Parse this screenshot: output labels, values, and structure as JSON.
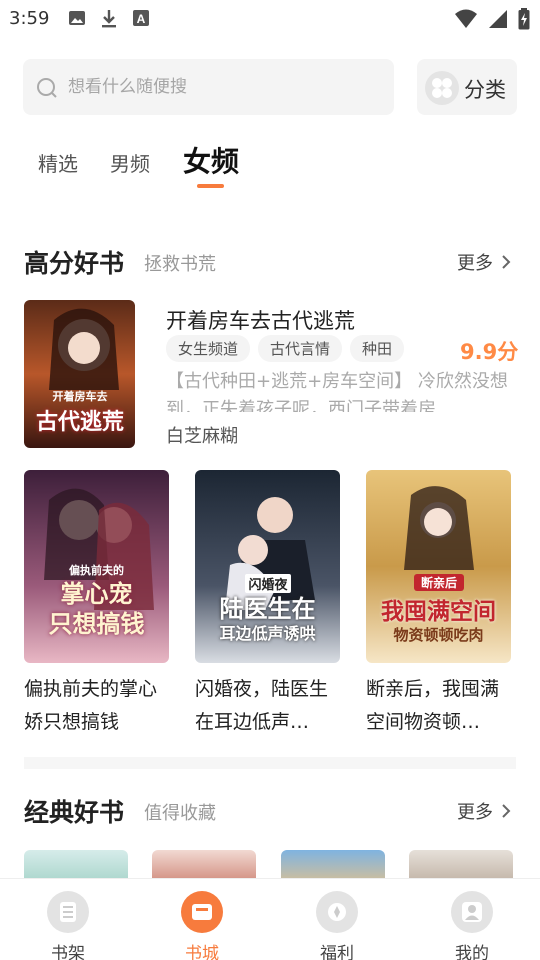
{
  "status_bar": {
    "time": "3:59"
  },
  "search": {
    "placeholder": "想看什么随便搜"
  },
  "category_button": {
    "label": "分类"
  },
  "tabs": [
    {
      "label": "精选",
      "active": false
    },
    {
      "label": "男频",
      "active": false
    },
    {
      "label": "女频",
      "active": true
    }
  ],
  "section_high_score": {
    "title": "高分好书",
    "subtitle": "拯救书荒",
    "more": "更多",
    "featured": {
      "title": "开着房车去古代逃荒",
      "tags": [
        "女生频道",
        "古代言情",
        "种田"
      ],
      "score": "9.9分",
      "description": "【古代种田+逃荒+房车空间】 冷欣然没想到，正失着孩子呢，西门子带着房",
      "author": "白芝麻糊",
      "cover_text": [
        "开着房车去",
        "古代逃荒"
      ]
    },
    "books": [
      {
        "title": "偏执前夫的掌心娇只想搞钱",
        "cover_text": [
          "偏执前夫的",
          "掌心宠",
          "只想搞钱"
        ]
      },
      {
        "title": "闪婚夜，陆医生在耳边低声…",
        "cover_text": [
          "闪婚夜",
          "陆医生在",
          "耳边低声诱哄"
        ]
      },
      {
        "title": "断亲后，我囤满空间物资顿…",
        "cover_text": [
          "断亲后",
          "我囤满空间",
          "物资顿顿吃肉"
        ]
      }
    ]
  },
  "section_classic": {
    "title": "经典好书",
    "subtitle": "值得收藏",
    "more": "更多"
  },
  "bottom_nav": [
    {
      "label": "书架",
      "icon": "bookshelf-icon",
      "active": false
    },
    {
      "label": "书城",
      "icon": "bookstore-icon",
      "active": true
    },
    {
      "label": "福利",
      "icon": "gift-icon",
      "active": false
    },
    {
      "label": "我的",
      "icon": "profile-icon",
      "active": false
    }
  ],
  "colors": {
    "accent": "#f77b3d",
    "score": "#ff8a45"
  }
}
